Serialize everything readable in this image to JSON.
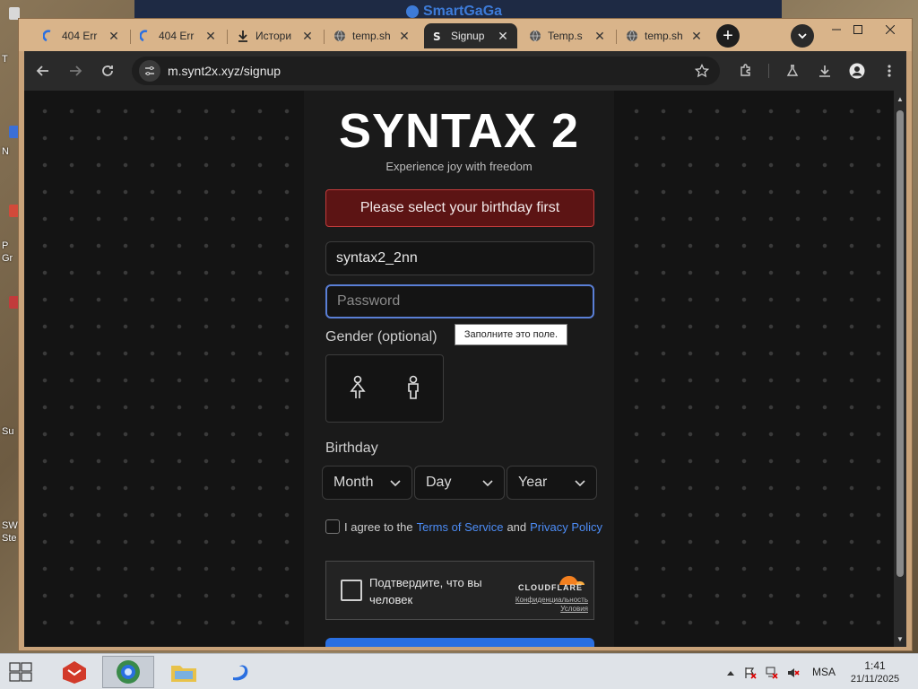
{
  "desktop": {
    "icon_labels": [
      "T",
      "N",
      "P",
      "Gr",
      "Su",
      "SW",
      "Ste"
    ],
    "bg_app_brand": "SmartGaGa"
  },
  "tabs": [
    {
      "title": "404 Err",
      "icon": "cloud-icon",
      "active": false
    },
    {
      "title": "404 Err",
      "icon": "cloud-icon",
      "active": false
    },
    {
      "title": "Истори",
      "icon": "download-icon",
      "active": false
    },
    {
      "title": "temp.sh",
      "icon": "globe-icon",
      "active": false
    },
    {
      "title": "Signup",
      "icon": "syntax-logo-icon",
      "active": true
    },
    {
      "title": "Temp.s",
      "icon": "globe-icon",
      "active": false
    },
    {
      "title": "temp.sh",
      "icon": "globe-icon",
      "active": false
    }
  ],
  "toolbar": {
    "url": "m.synt2x.xyz/signup"
  },
  "page": {
    "title": "SYNTAX 2",
    "subtitle": "Experience joy with freedom",
    "error": "Please select your birthday first",
    "username_value": "syntax2_2nn",
    "password_placeholder": "Password",
    "tooltip": "Заполните это поле.",
    "gender_label": "Gender (optional)",
    "birthday_label": "Birthday",
    "month": "Month",
    "day": "Day",
    "year": "Year",
    "terms_prefix": "I agree to the",
    "terms_link": "Terms of Service",
    "terms_and": "and",
    "privacy_link": "Privacy Policy"
  },
  "captcha": {
    "text": "Подтвердите, что вы человек",
    "brand": "CLOUDFLARE",
    "privacy": "Конфиденциальность",
    "terms": "Условия"
  },
  "taskbar": {
    "lang": "MSA",
    "time": "1:41",
    "date": "21/11/2025"
  },
  "colors": {
    "accent": "#2a6fe0",
    "error_bg": "#5c1414",
    "link": "#4d8df7",
    "cloudflare": "#f38020"
  }
}
